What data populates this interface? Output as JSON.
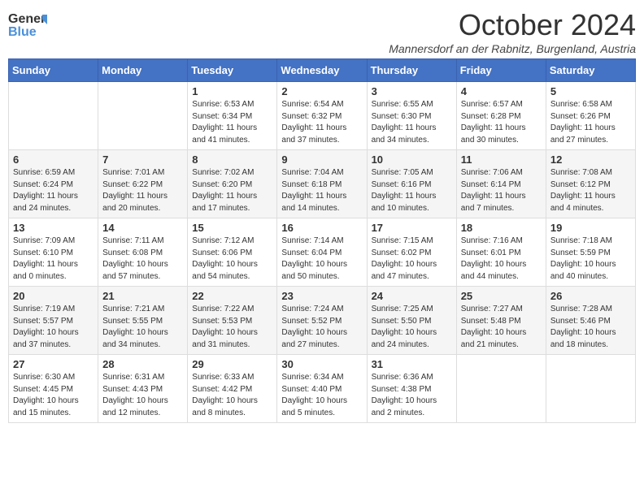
{
  "logo": {
    "text_general": "General",
    "text_blue": "Blue"
  },
  "title": "October 2024",
  "subtitle": "Mannersdorf an der Rabnitz, Burgenland, Austria",
  "weekdays": [
    "Sunday",
    "Monday",
    "Tuesday",
    "Wednesday",
    "Thursday",
    "Friday",
    "Saturday"
  ],
  "weeks": [
    [
      {
        "day": "",
        "info": ""
      },
      {
        "day": "",
        "info": ""
      },
      {
        "day": "1",
        "info": "Sunrise: 6:53 AM\nSunset: 6:34 PM\nDaylight: 11 hours and 41 minutes."
      },
      {
        "day": "2",
        "info": "Sunrise: 6:54 AM\nSunset: 6:32 PM\nDaylight: 11 hours and 37 minutes."
      },
      {
        "day": "3",
        "info": "Sunrise: 6:55 AM\nSunset: 6:30 PM\nDaylight: 11 hours and 34 minutes."
      },
      {
        "day": "4",
        "info": "Sunrise: 6:57 AM\nSunset: 6:28 PM\nDaylight: 11 hours and 30 minutes."
      },
      {
        "day": "5",
        "info": "Sunrise: 6:58 AM\nSunset: 6:26 PM\nDaylight: 11 hours and 27 minutes."
      }
    ],
    [
      {
        "day": "6",
        "info": "Sunrise: 6:59 AM\nSunset: 6:24 PM\nDaylight: 11 hours and 24 minutes."
      },
      {
        "day": "7",
        "info": "Sunrise: 7:01 AM\nSunset: 6:22 PM\nDaylight: 11 hours and 20 minutes."
      },
      {
        "day": "8",
        "info": "Sunrise: 7:02 AM\nSunset: 6:20 PM\nDaylight: 11 hours and 17 minutes."
      },
      {
        "day": "9",
        "info": "Sunrise: 7:04 AM\nSunset: 6:18 PM\nDaylight: 11 hours and 14 minutes."
      },
      {
        "day": "10",
        "info": "Sunrise: 7:05 AM\nSunset: 6:16 PM\nDaylight: 11 hours and 10 minutes."
      },
      {
        "day": "11",
        "info": "Sunrise: 7:06 AM\nSunset: 6:14 PM\nDaylight: 11 hours and 7 minutes."
      },
      {
        "day": "12",
        "info": "Sunrise: 7:08 AM\nSunset: 6:12 PM\nDaylight: 11 hours and 4 minutes."
      }
    ],
    [
      {
        "day": "13",
        "info": "Sunrise: 7:09 AM\nSunset: 6:10 PM\nDaylight: 11 hours and 0 minutes."
      },
      {
        "day": "14",
        "info": "Sunrise: 7:11 AM\nSunset: 6:08 PM\nDaylight: 10 hours and 57 minutes."
      },
      {
        "day": "15",
        "info": "Sunrise: 7:12 AM\nSunset: 6:06 PM\nDaylight: 10 hours and 54 minutes."
      },
      {
        "day": "16",
        "info": "Sunrise: 7:14 AM\nSunset: 6:04 PM\nDaylight: 10 hours and 50 minutes."
      },
      {
        "day": "17",
        "info": "Sunrise: 7:15 AM\nSunset: 6:02 PM\nDaylight: 10 hours and 47 minutes."
      },
      {
        "day": "18",
        "info": "Sunrise: 7:16 AM\nSunset: 6:01 PM\nDaylight: 10 hours and 44 minutes."
      },
      {
        "day": "19",
        "info": "Sunrise: 7:18 AM\nSunset: 5:59 PM\nDaylight: 10 hours and 40 minutes."
      }
    ],
    [
      {
        "day": "20",
        "info": "Sunrise: 7:19 AM\nSunset: 5:57 PM\nDaylight: 10 hours and 37 minutes."
      },
      {
        "day": "21",
        "info": "Sunrise: 7:21 AM\nSunset: 5:55 PM\nDaylight: 10 hours and 34 minutes."
      },
      {
        "day": "22",
        "info": "Sunrise: 7:22 AM\nSunset: 5:53 PM\nDaylight: 10 hours and 31 minutes."
      },
      {
        "day": "23",
        "info": "Sunrise: 7:24 AM\nSunset: 5:52 PM\nDaylight: 10 hours and 27 minutes."
      },
      {
        "day": "24",
        "info": "Sunrise: 7:25 AM\nSunset: 5:50 PM\nDaylight: 10 hours and 24 minutes."
      },
      {
        "day": "25",
        "info": "Sunrise: 7:27 AM\nSunset: 5:48 PM\nDaylight: 10 hours and 21 minutes."
      },
      {
        "day": "26",
        "info": "Sunrise: 7:28 AM\nSunset: 5:46 PM\nDaylight: 10 hours and 18 minutes."
      }
    ],
    [
      {
        "day": "27",
        "info": "Sunrise: 6:30 AM\nSunset: 4:45 PM\nDaylight: 10 hours and 15 minutes."
      },
      {
        "day": "28",
        "info": "Sunrise: 6:31 AM\nSunset: 4:43 PM\nDaylight: 10 hours and 12 minutes."
      },
      {
        "day": "29",
        "info": "Sunrise: 6:33 AM\nSunset: 4:42 PM\nDaylight: 10 hours and 8 minutes."
      },
      {
        "day": "30",
        "info": "Sunrise: 6:34 AM\nSunset: 4:40 PM\nDaylight: 10 hours and 5 minutes."
      },
      {
        "day": "31",
        "info": "Sunrise: 6:36 AM\nSunset: 4:38 PM\nDaylight: 10 hours and 2 minutes."
      },
      {
        "day": "",
        "info": ""
      },
      {
        "day": "",
        "info": ""
      }
    ]
  ]
}
